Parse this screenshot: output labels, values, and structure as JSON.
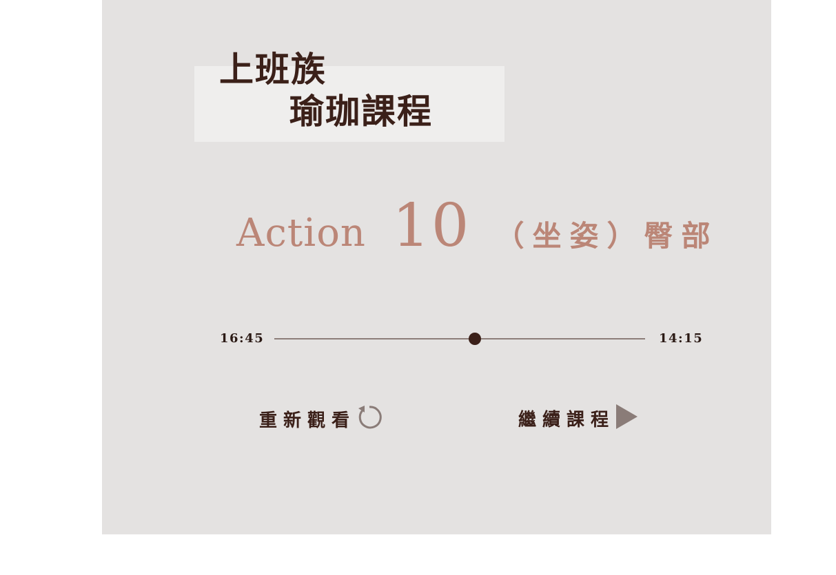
{
  "title": {
    "line1": "上班族",
    "line2": "瑜珈課程"
  },
  "action": {
    "word": "Action",
    "number": "10",
    "subtitle": "（坐姿）臀部"
  },
  "player": {
    "elapsed": "16:45",
    "remaining": "14:15",
    "progress": 0.54
  },
  "buttons": {
    "replay_label": "重新觀看",
    "continue_label": "繼續課程"
  },
  "icons": {
    "replay": "replay-icon",
    "play": "play-icon"
  },
  "colors": {
    "panel": "#e4e2e1",
    "title_box": "#efeeed",
    "title_text": "#3b2019",
    "accent": "#bb8677",
    "play_icon": "#8a7c78"
  }
}
